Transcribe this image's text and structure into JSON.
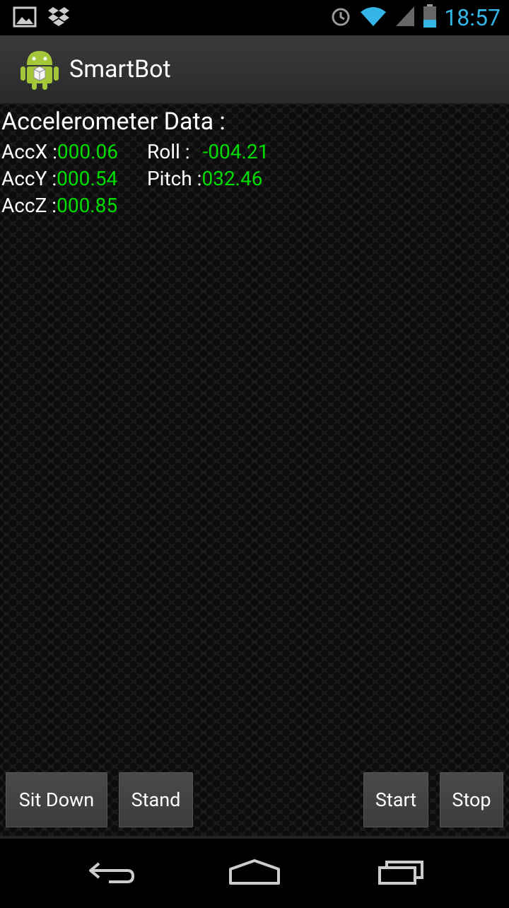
{
  "status": {
    "time": "18:57"
  },
  "app": {
    "title": "SmartBot"
  },
  "accelerometer": {
    "title": "Accelerometer Data :",
    "accx_label": "AccX :",
    "accx_value": "000.06",
    "accy_label": "AccY :",
    "accy_value": "000.54",
    "accz_label": "AccZ :",
    "accz_value": "000.85",
    "roll_label": "Roll :",
    "roll_value": "-004.21",
    "pitch_label": "Pitch :",
    "pitch_value": "032.46"
  },
  "buttons": {
    "sit_down": "Sit Down",
    "stand": "Stand",
    "start": "Start",
    "stop": "Stop"
  },
  "colors": {
    "value_green": "#00dd00",
    "clock_blue": "#33b5e5"
  }
}
